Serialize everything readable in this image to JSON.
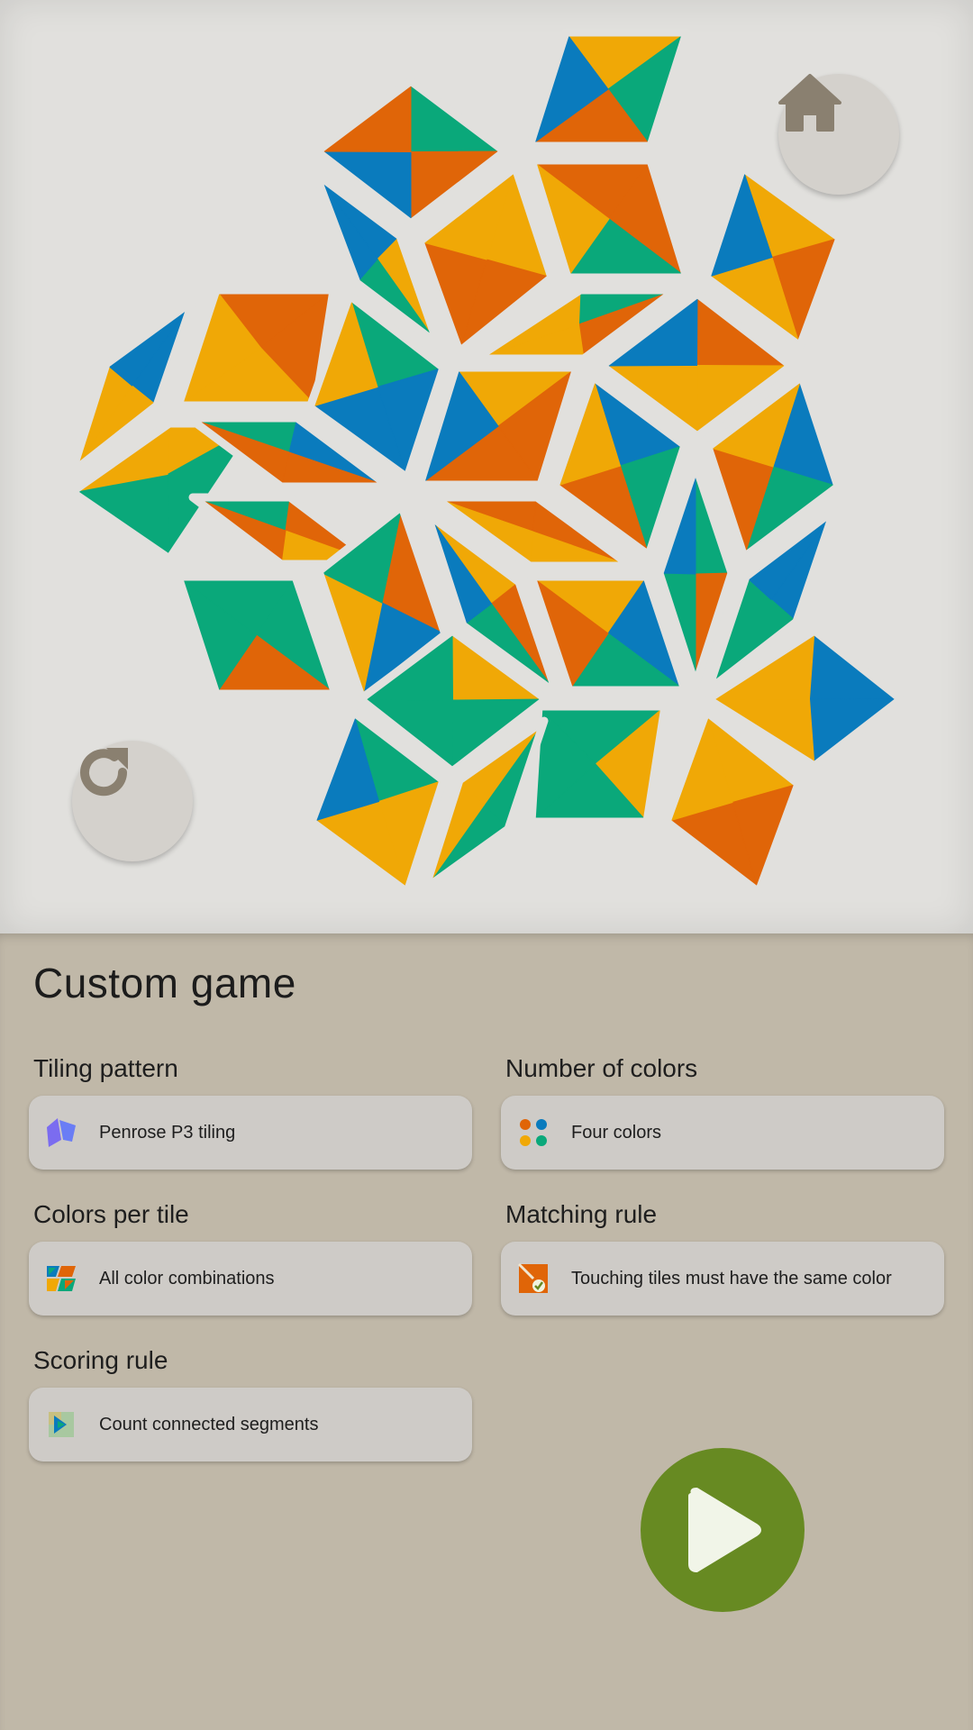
{
  "colors": {
    "blue": "#0a7bbd",
    "orange": "#e06508",
    "yellow": "#f0a806",
    "green": "#0aa87a",
    "background": "#e1e0dd",
    "panel": "#c0b8a8",
    "play": "#678a22"
  },
  "preview": {
    "home_icon": "home-icon",
    "reset_icon": "reset-icon"
  },
  "panel": {
    "title": "Custom game",
    "tiling": {
      "label": "Tiling pattern",
      "value": "Penrose P3 tiling",
      "icon": "rhombus-tiling-icon"
    },
    "colors_count": {
      "label": "Number of colors",
      "value": "Four colors",
      "icon": "four-dots-icon"
    },
    "colors_per_tile": {
      "label": "Colors per tile",
      "value": "All color combinations",
      "icon": "color-combinations-icon"
    },
    "matching": {
      "label": "Matching rule",
      "value": "Touching tiles must have the same color",
      "icon": "matching-rule-icon"
    },
    "scoring": {
      "label": "Scoring rule",
      "value": "Count connected segments",
      "icon": "connected-segments-icon"
    },
    "play_icon": "play-icon"
  }
}
